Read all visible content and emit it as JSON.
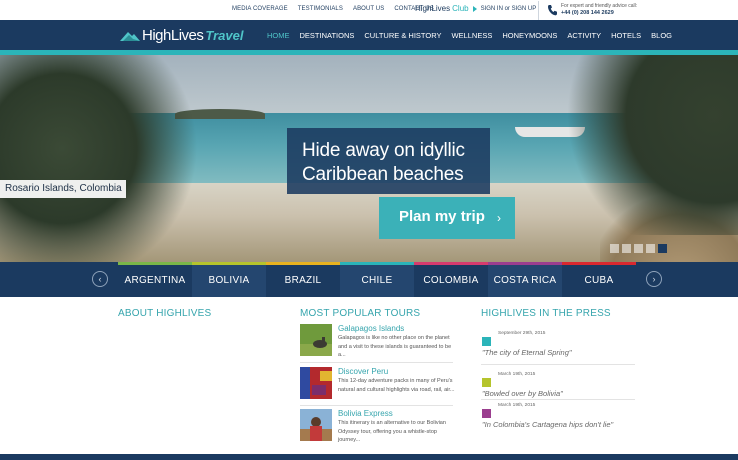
{
  "topbar": {
    "links": [
      "MEDIA COVERAGE",
      "TESTIMONIALS",
      "ABOUT US",
      "CONTACT US"
    ],
    "club_brand": "HighLives",
    "club_accent": "Club",
    "sign_text": "SIGN IN or SIGN UP",
    "advice_text": "For expert and friendly advice call:",
    "phone": "+44 (0) 208 144 2629"
  },
  "navbar": {
    "logo_primary": "HighLives",
    "logo_secondary": "Travel",
    "items": [
      {
        "label": "HOME",
        "active": true
      },
      {
        "label": "DESTINATIONS",
        "active": false
      },
      {
        "label": "CULTURE & HISTORY",
        "active": false
      },
      {
        "label": "WELLNESS",
        "active": false
      },
      {
        "label": "HONEYMOONS",
        "active": false
      },
      {
        "label": "ACTIVITY",
        "active": false
      },
      {
        "label": "HOTELS",
        "active": false
      },
      {
        "label": "BLOG",
        "active": false
      }
    ]
  },
  "hero": {
    "location": "Rosario Islands, Colombia",
    "headline_line1": "Hide away on idyllic",
    "headline_line2": "Caribbean beaches",
    "cta_label": "Plan my trip",
    "slides": 5,
    "active_slide": 5
  },
  "countries": [
    {
      "name": "ARGENTINA",
      "color": "#7ab648"
    },
    {
      "name": "BOLIVIA",
      "color": "#b5c42c"
    },
    {
      "name": "BRAZIL",
      "color": "#e8b21f"
    },
    {
      "name": "CHILE",
      "color": "#2bb4b9"
    },
    {
      "name": "COLOMBIA",
      "color": "#d63b6e"
    },
    {
      "name": "COSTA RICA",
      "color": "#9b3e8f"
    },
    {
      "name": "CUBA",
      "color": "#d9282f"
    }
  ],
  "sections": {
    "about_title": "ABOUT HIGHLIVES",
    "tours_title": "MOST POPULAR TOURS",
    "press_title": "HIGHLIVES IN THE PRESS"
  },
  "tours": [
    {
      "title": "Galapagos Islands",
      "desc": "Galapagos is like no other place on the planet and a visit to these islands is guaranteed to be a..."
    },
    {
      "title": "Discover Peru",
      "desc": "This 12-day adventure packs in many of Peru's natural and cultural highlights via road, rail, air..."
    },
    {
      "title": "Bolivia Express",
      "desc": "This itinerary is an alternative to our Bolivian Odyssey tour, offering you a whistle-stop journey..."
    }
  ],
  "press": [
    {
      "date": "September 29th, 2015",
      "quote": "\"The city of Eternal Spring\"",
      "color": "#2bb4b9"
    },
    {
      "date": "March 19th, 2015",
      "quote": "\"Bowled over by Bolivia\"",
      "color": "#b5c42c"
    },
    {
      "date": "March 19th, 2015",
      "quote": "\"In Colombia's Cartagena hips don't lie\"",
      "color": "#9b3e8f"
    }
  ],
  "icons": {
    "phone": "phone-icon",
    "prev": "chevron-left-icon",
    "next": "chevron-right-icon",
    "cta_arrow": "chevron-right-icon"
  },
  "colors": {
    "navy": "#1b3a60",
    "teal": "#2bb4b9",
    "teal_text": "#36a5ad"
  }
}
